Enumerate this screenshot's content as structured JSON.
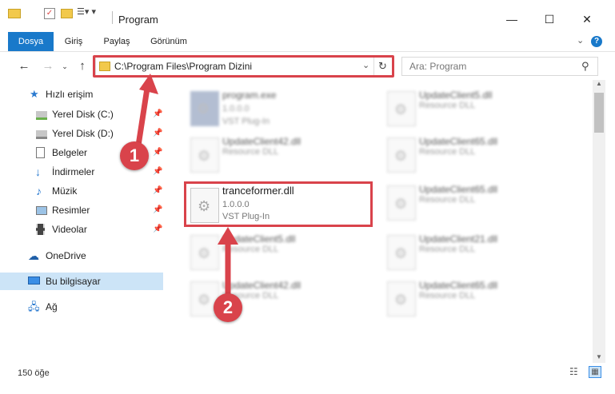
{
  "window": {
    "title": "Program",
    "minimize_icon": "minimize-icon",
    "maximize_icon": "maximize-icon",
    "close_icon": "close-icon"
  },
  "ribbon": {
    "tabs": [
      "Dosya",
      "Giriş",
      "Paylaş",
      "Görünüm"
    ],
    "accent_color": "#1979ca"
  },
  "navigation": {
    "address": "C:\\Program Files\\Program Dizini",
    "search_placeholder": "Ara: Program"
  },
  "sidebar": {
    "items": [
      {
        "label": "Hızlı erişim",
        "icon": "star-icon",
        "pinned": false
      },
      {
        "label": "Yerel Disk (C:)",
        "icon": "drive-icon",
        "pinned": true
      },
      {
        "label": "Yerel Disk (D:)",
        "icon": "drive-icon",
        "pinned": true
      },
      {
        "label": "Belgeler",
        "icon": "documents-icon",
        "pinned": true
      },
      {
        "label": "İndirmeler",
        "icon": "download-icon",
        "pinned": true
      },
      {
        "label": "Müzik",
        "icon": "music-icon",
        "pinned": true
      },
      {
        "label": "Resimler",
        "icon": "pictures-icon",
        "pinned": true
      },
      {
        "label": "Videolar",
        "icon": "videos-icon",
        "pinned": true
      },
      {
        "label": "OneDrive",
        "icon": "cloud-icon",
        "pinned": false
      },
      {
        "label": "Bu bilgisayar",
        "icon": "computer-icon",
        "pinned": false
      },
      {
        "label": "Ağ",
        "icon": "network-icon",
        "pinned": false
      }
    ]
  },
  "files": [
    {
      "name": "program.exe",
      "version": "1.0.0.0",
      "type": "VST Plug-In"
    },
    {
      "name": "UpdateClient5.dll",
      "version": "",
      "type": "Resource DLL"
    },
    {
      "name": "UpdateClient42.dll",
      "version": "",
      "type": "Resource DLL"
    },
    {
      "name": "UpdateClient65.dll",
      "version": "",
      "type": "Resource DLL"
    },
    {
      "name": "tranceformer.dll",
      "version": "1.0.0.0",
      "type": "VST Plug-In"
    },
    {
      "name": "UpdateClient65.dll",
      "version": "",
      "type": "Resource DLL"
    },
    {
      "name": "UpdateClient5.dll",
      "version": "",
      "type": "Resource DLL"
    },
    {
      "name": "UpdateClient21.dll",
      "version": "",
      "type": "Resource DLL"
    },
    {
      "name": "UpdateClient42.dll",
      "version": "",
      "type": "Resource DLL"
    },
    {
      "name": "UpdateClient65.dll",
      "version": "",
      "type": "Resource DLL"
    }
  ],
  "annotations": {
    "step1": "1",
    "step2": "2",
    "color": "#d9434b"
  },
  "status": {
    "item_count": "150 öğe"
  }
}
